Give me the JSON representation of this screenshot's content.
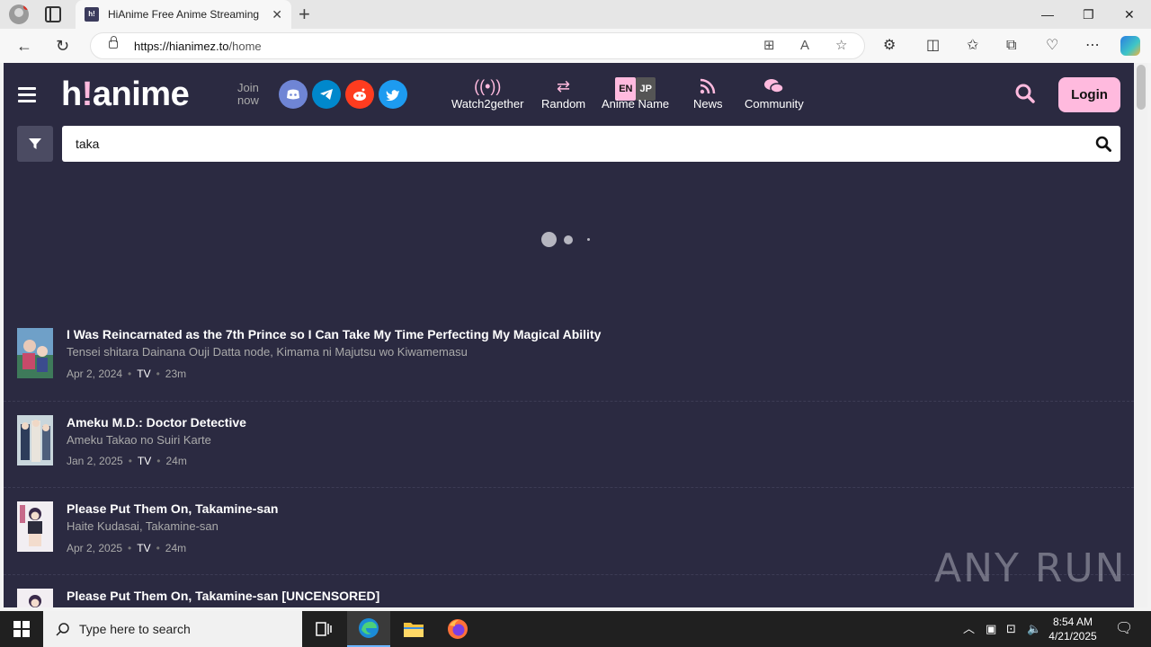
{
  "browser": {
    "tab_title": "HiAnime Free Anime Streaming H",
    "tab_favicon": "h!",
    "url_host": "https://hianimez.to",
    "url_path": "/home"
  },
  "header": {
    "logo_pre": "h",
    "logo_bang": "!",
    "logo_post": "anime",
    "join_line1": "Join",
    "join_line2": "now",
    "socials": [
      {
        "name": "discord-icon",
        "color": "#6f85d5"
      },
      {
        "name": "telegram-icon",
        "color": "#0088cc"
      },
      {
        "name": "reddit-icon",
        "color": "#ff3c1f"
      },
      {
        "name": "twitter-icon",
        "color": "#1d9bf0"
      }
    ],
    "nav": {
      "watch2gether": "Watch2gether",
      "random": "Random",
      "anime_name": "Anime Name",
      "lang_en": "EN",
      "lang_jp": "JP",
      "news": "News",
      "community": "Community"
    },
    "login_label": "Login"
  },
  "search": {
    "value": "taka"
  },
  "results": [
    {
      "title": "I Was Reincarnated as the 7th Prince so I Can Take My Time Perfecting My Magical Ability",
      "alt": "Tensei shitara Dainana Ouji Datta node, Kimama ni Majutsu wo Kiwamemasu",
      "date": "Apr 2, 2024",
      "type": "TV",
      "duration": "23m"
    },
    {
      "title": "Ameku M.D.: Doctor Detective",
      "alt": "Ameku Takao no Suiri Karte",
      "date": "Jan 2, 2025",
      "type": "TV",
      "duration": "24m"
    },
    {
      "title": "Please Put Them On, Takamine-san",
      "alt": "Haite Kudasai, Takamine-san",
      "date": "Apr 2, 2025",
      "type": "TV",
      "duration": "24m"
    },
    {
      "title": "Please Put Them On, Takamine-san [UNCENSORED]"
    }
  ],
  "watermark": "ANY RUN",
  "taskbar": {
    "search_placeholder": "Type here to search",
    "time": "8:54 AM",
    "date": "4/21/2025"
  }
}
